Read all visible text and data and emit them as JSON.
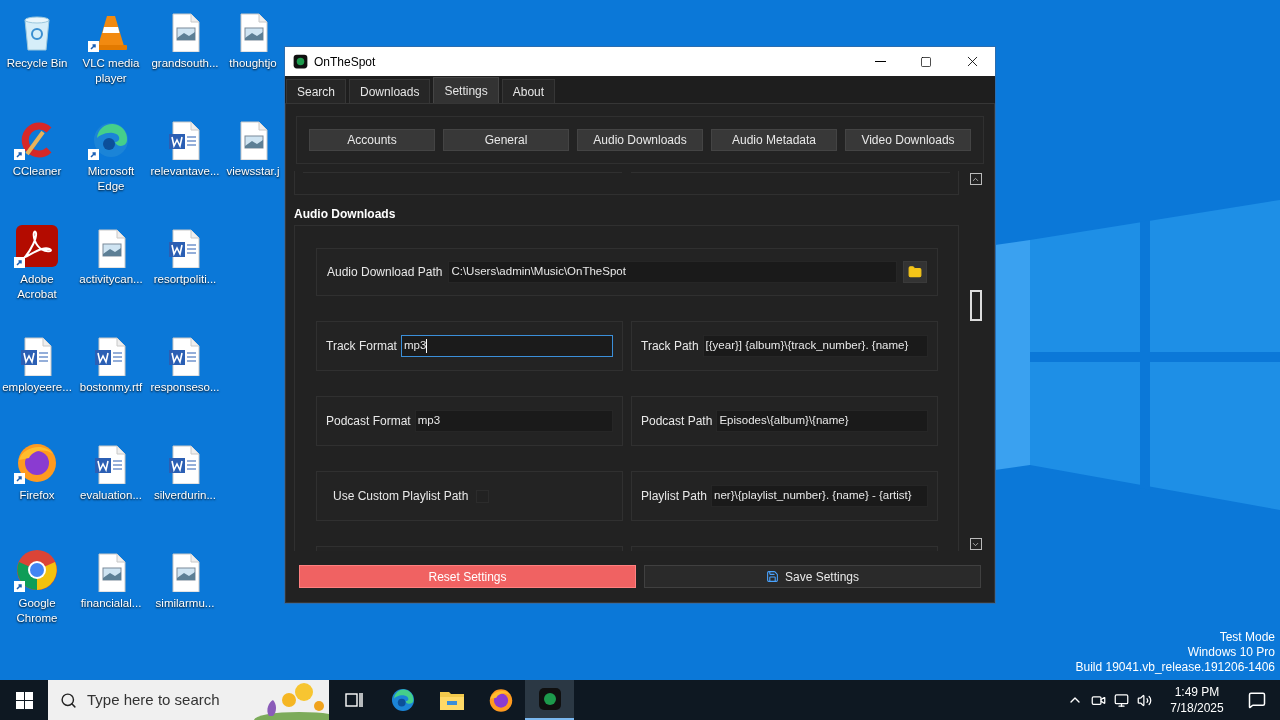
{
  "desktop_icons": [
    {
      "label": "Recycle Bin",
      "kind": "recycle",
      "shortcut": false
    },
    {
      "label": "CCleaner",
      "kind": "ccleaner",
      "shortcut": true
    },
    {
      "label": "Adobe Acrobat",
      "kind": "acrobat",
      "shortcut": true
    },
    {
      "label": "employeere...",
      "kind": "word",
      "shortcut": false
    },
    {
      "label": "Firefox",
      "kind": "firefox",
      "shortcut": true
    },
    {
      "label": "Google Chrome",
      "kind": "chrome",
      "shortcut": true
    },
    {
      "label": "VLC media player",
      "kind": "vlc",
      "shortcut": true
    },
    {
      "label": "Microsoft Edge",
      "kind": "edge",
      "shortcut": true
    },
    {
      "label": "activitycan...",
      "kind": "image",
      "shortcut": false
    },
    {
      "label": "bostonmy.rtf",
      "kind": "word",
      "shortcut": false
    },
    {
      "label": "evaluation...",
      "kind": "word",
      "shortcut": false
    },
    {
      "label": "financialal...",
      "kind": "image",
      "shortcut": false
    },
    {
      "label": "grandsouth...",
      "kind": "image",
      "shortcut": false
    },
    {
      "label": "relevantave...",
      "kind": "word",
      "shortcut": false
    },
    {
      "label": "resortpoliti...",
      "kind": "word",
      "shortcut": false
    },
    {
      "label": "responseso...",
      "kind": "word",
      "shortcut": false
    },
    {
      "label": "silverdurin...",
      "kind": "word",
      "shortcut": false
    },
    {
      "label": "similarmu...",
      "kind": "image",
      "shortcut": false
    },
    {
      "label": "thoughtjo",
      "kind": "image",
      "shortcut": false
    },
    {
      "label": "viewsstar.j",
      "kind": "image",
      "shortcut": false
    }
  ],
  "window": {
    "title": "OnTheSpot"
  },
  "tabs": [
    {
      "label": "Search",
      "selected": false
    },
    {
      "label": "Downloads",
      "selected": false
    },
    {
      "label": "Settings",
      "selected": true
    },
    {
      "label": "About",
      "selected": false
    }
  ],
  "settings_sections": [
    "Accounts",
    "General",
    "Audio Downloads",
    "Audio Metadata",
    "Video Downloads"
  ],
  "section_title": "Audio Downloads",
  "rows": [
    [
      {
        "kind": "path",
        "label": "Audio Download Path",
        "value": "C:\\Users\\admin\\Music\\OnTheSpot",
        "focused": false
      }
    ],
    [
      {
        "kind": "field",
        "label": "Track Format",
        "value": "mp3",
        "focused": true
      },
      {
        "kind": "field",
        "label": "Track Path",
        "value": "[{year}] {album}\\{track_number}. {name}",
        "focused": false
      }
    ],
    [
      {
        "kind": "field",
        "label": "Podcast Format",
        "value": "mp3",
        "focused": false
      },
      {
        "kind": "field",
        "label": "Podcast Path",
        "value": "Episodes\\{album}\\{name}",
        "focused": false
      }
    ],
    [
      {
        "kind": "checkbox",
        "label": "Use Custom Playlist Path",
        "checked": false
      },
      {
        "kind": "field",
        "label": "Playlist Path",
        "value": "ner}\\{playlist_number}. {name} - {artist}",
        "focused": false
      }
    ]
  ],
  "footer_buttons": [
    {
      "label": "Reset Settings",
      "kind": "danger"
    },
    {
      "label": "Save Settings",
      "kind": "save"
    }
  ],
  "os_notice": [
    "Test Mode",
    "Windows 10 Pro",
    "Build 19041.vb_release.191206-1406"
  ],
  "taskbar": {
    "search_placeholder": "Type here to search",
    "apps": [
      {
        "kind": "taskview",
        "selected": false
      },
      {
        "kind": "edge",
        "selected": false
      },
      {
        "kind": "explorer",
        "selected": false
      },
      {
        "kind": "firefox",
        "selected": false
      },
      {
        "kind": "onthespot",
        "selected": true
      }
    ],
    "time": "1:49 PM",
    "date": "7/18/2025"
  }
}
